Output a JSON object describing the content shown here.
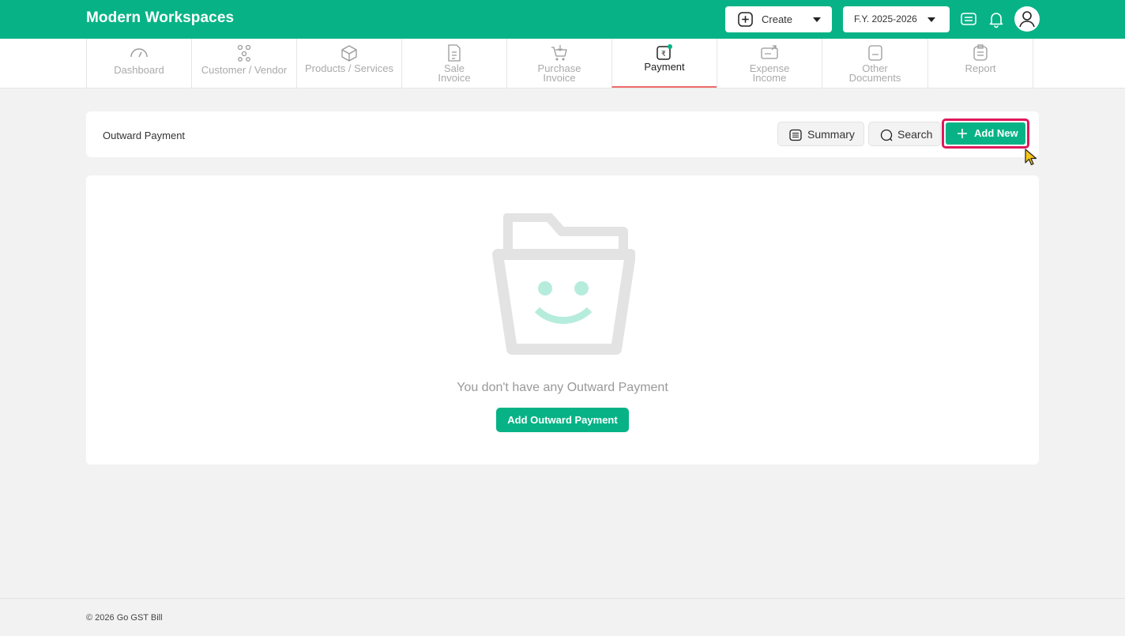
{
  "header": {
    "brand": "Modern Workspaces",
    "create_label": "Create",
    "fy_label": "F.Y. 2025-2026",
    "accent_color": "#07b386"
  },
  "nav": {
    "items": [
      {
        "label": "Dashboard",
        "icon": "gauge-icon"
      },
      {
        "label": "Customer / Vendor",
        "icon": "users-icon"
      },
      {
        "label": "Products / Services",
        "icon": "box-icon"
      },
      {
        "label_line1": "Sale",
        "label_line2": "Invoice",
        "icon": "invoice-icon"
      },
      {
        "label_line1": "Purchase",
        "label_line2": "Invoice",
        "icon": "cart-icon"
      },
      {
        "label": "Payment",
        "icon": "payment-icon",
        "active": true
      },
      {
        "label_line1": "Expense",
        "label_line2": "Income",
        "icon": "wallet-icon"
      },
      {
        "label_line1": "Other",
        "label_line2": "Documents",
        "icon": "document-icon"
      },
      {
        "label": "Report",
        "icon": "report-icon"
      }
    ]
  },
  "toolbar": {
    "title": "Outward Payment",
    "summary_label": "Summary",
    "search_label": "Search",
    "add_new_label": "Add New"
  },
  "empty_state": {
    "message": "You don't have any Outward Payment",
    "cta_label": "Add Outward Payment"
  },
  "footer": {
    "text": "© 2026 Go GST Bill"
  }
}
